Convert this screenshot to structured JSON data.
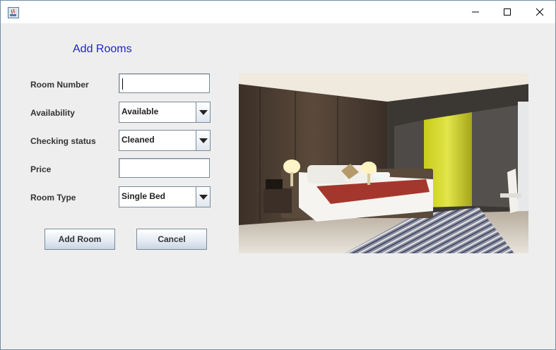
{
  "window": {
    "title": "",
    "controls": [
      "minimize",
      "maximize",
      "close"
    ]
  },
  "form": {
    "heading": "Add Rooms",
    "fields": {
      "room_number": {
        "label": "Room Number",
        "value": ""
      },
      "availability": {
        "label": "Availability",
        "selected": "Available"
      },
      "checking_status": {
        "label": "Checking status",
        "selected": "Cleaned"
      },
      "price": {
        "label": "Price",
        "value": ""
      },
      "room_type": {
        "label": "Room Type",
        "selected": "Single Bed"
      }
    },
    "buttons": {
      "add": "Add Room",
      "cancel": "Cancel"
    }
  },
  "image": {
    "subject": "hotel-room-photo"
  },
  "colors": {
    "heading": "#1f1fd6",
    "window_bg": "#eeeeee"
  }
}
